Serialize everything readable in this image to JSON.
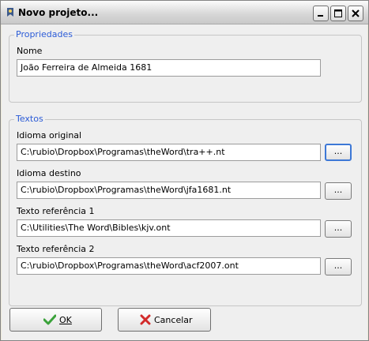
{
  "window": {
    "title": "Novo projeto...",
    "controls": {
      "minimize": "minimize",
      "maximize": "maximize",
      "close": "close"
    }
  },
  "propriedades": {
    "legend": "Propriedades",
    "nome_label": "Nome",
    "nome_value": "João Ferreira de Almeida 1681"
  },
  "textos": {
    "legend": "Textos",
    "fields": [
      {
        "label": "Idioma original",
        "value": "C:\\rubio\\Dropbox\\Programas\\theWord\\tra++.nt",
        "browse": "..."
      },
      {
        "label": "Idioma destino",
        "value": "C:\\rubio\\Dropbox\\Programas\\theWord\\jfa1681.nt",
        "browse": "..."
      },
      {
        "label": "Texto referência 1",
        "value": "C:\\Utilities\\The Word\\Bibles\\kjv.ont",
        "browse": "..."
      },
      {
        "label": "Texto referência 2",
        "value": "C:\\rubio\\Dropbox\\Programas\\theWord\\acf2007.ont",
        "browse": "..."
      }
    ]
  },
  "buttons": {
    "ok": "OK",
    "cancel": "Cancelar"
  },
  "colors": {
    "legend": "#2b5bd7",
    "ok_check": "#3aa23a",
    "cancel_x": "#d22a2a",
    "focus": "#3d78d6"
  }
}
